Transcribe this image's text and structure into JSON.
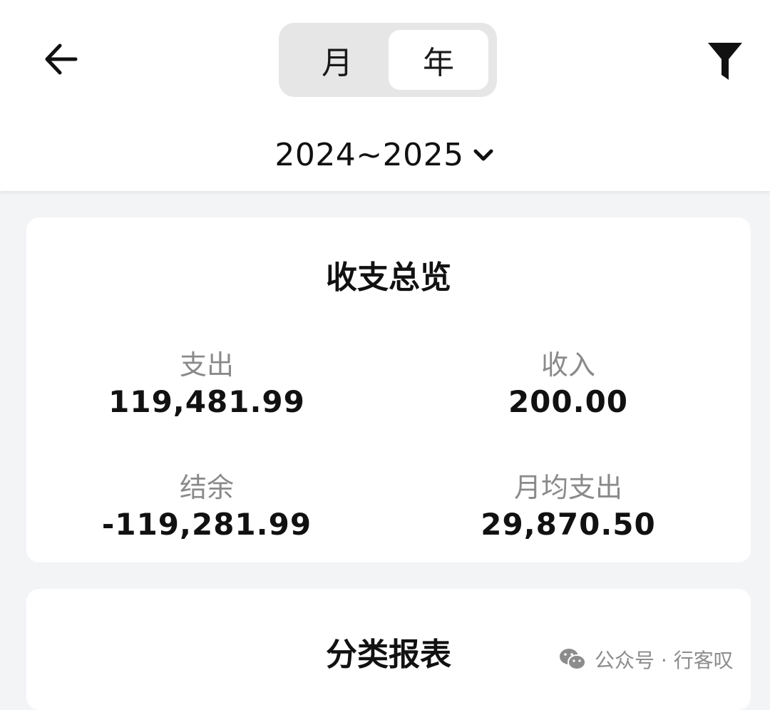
{
  "header": {
    "back_icon": "arrow-left-icon",
    "filter_icon": "funnel-icon",
    "segments": {
      "month": "月",
      "year": "年",
      "selected": "year"
    },
    "range": {
      "label": "2024~2025",
      "icon": "chevron-down-icon"
    }
  },
  "overview": {
    "title": "收支总览",
    "expense_label": "支出",
    "expense_value": "119,481.99",
    "income_label": "收入",
    "income_value": "200.00",
    "balance_label": "结余",
    "balance_value": "-119,281.99",
    "monthly_avg_label": "月均支出",
    "monthly_avg_value": "29,870.50"
  },
  "category": {
    "title": "分类报表"
  },
  "watermark": {
    "icon": "wechat-icon",
    "text": "公众号 · 行客叹"
  }
}
